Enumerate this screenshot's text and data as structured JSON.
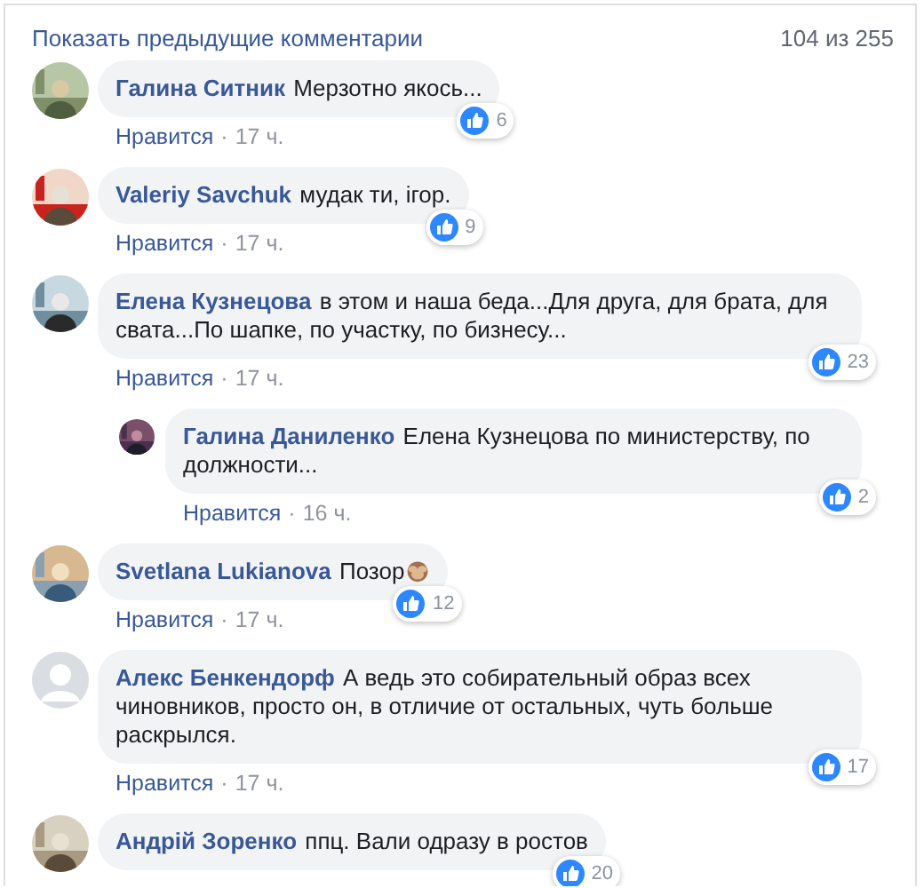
{
  "header": {
    "link": "Показать предыдущие комментарии",
    "count": "104 из 255"
  },
  "comments": [
    {
      "author": "Галина Ситник",
      "text": "Мерзотно якось...",
      "emoji": false,
      "like": "Нравится",
      "dot": "·",
      "time": "17 ч.",
      "reactions": "6"
    },
    {
      "author": "Valeriy Savchuk",
      "text": "мудак ти, ігор.",
      "emoji": false,
      "like": "Нравится",
      "dot": "·",
      "time": "17 ч.",
      "reactions": "9"
    },
    {
      "author": "Елена Кузнецова",
      "text": "в этом и наша беда...Для друга, для брата, для свата...По шапке, по участку, по бизнесу...",
      "emoji": false,
      "like": "Нравится",
      "dot": "·",
      "time": "17 ч.",
      "reactions": "23",
      "replies": [
        {
          "author": "Галина Даниленко",
          "text": "Елена Кузнецова по министерству, по должности...",
          "emoji": false,
          "like": "Нравится",
          "dot": "·",
          "time": "16 ч.",
          "reactions": "2"
        }
      ]
    },
    {
      "author": "Svetlana Lukianova",
      "text": "Позор",
      "emoji": true,
      "like": "Нравится",
      "dot": "·",
      "time": "17 ч.",
      "reactions": "12"
    },
    {
      "kind": "default",
      "author": "Алекс Бенкендорф",
      "text": "А ведь это собирательный образ всех чиновников, просто он, в отличие от остальных, чуть больше раскрылся.",
      "emoji": false,
      "like": "Нравится",
      "dot": "·",
      "time": "17 ч.",
      "reactions": "17"
    },
    {
      "author": "Андрій Зоренко",
      "text": "ппц. Вали одразу в ростов",
      "emoji": false,
      "reactions": "20"
    }
  ]
}
